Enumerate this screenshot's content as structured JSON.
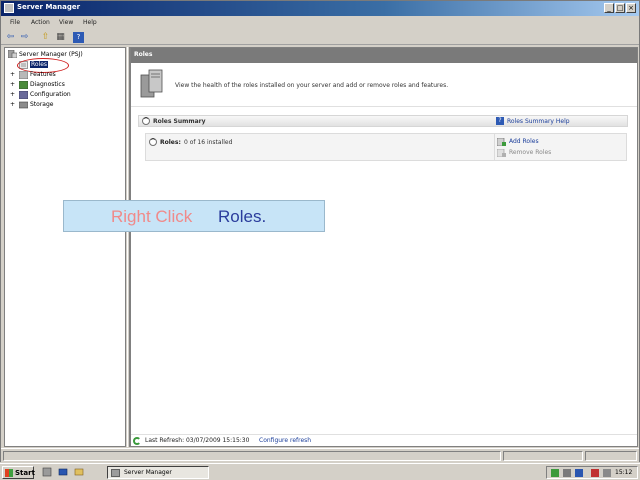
{
  "window": {
    "title": "Server Manager",
    "controls": {
      "minimize": "_",
      "maximize": "□",
      "close": "×"
    }
  },
  "menu": [
    "File",
    "Action",
    "View",
    "Help"
  ],
  "toolbar": {
    "buttons": [
      {
        "name": "back-icon",
        "glyph": "⇦"
      },
      {
        "name": "forward-icon",
        "glyph": "⇨"
      },
      {
        "name": "up-folder-icon",
        "glyph": "⇧"
      },
      {
        "name": "show-hide-tree-icon",
        "glyph": "▦"
      },
      {
        "name": "help-icon",
        "glyph": "?"
      }
    ]
  },
  "tree": {
    "root": "Server Manager (PSJ)",
    "items": [
      {
        "label": "Roles",
        "expander": "",
        "selected": true
      },
      {
        "label": "Features",
        "expander": "+"
      },
      {
        "label": "Diagnostics",
        "expander": "+"
      },
      {
        "label": "Configuration",
        "expander": "+"
      },
      {
        "label": "Storage",
        "expander": "+"
      }
    ]
  },
  "content": {
    "header": "Roles",
    "description": "View the health of the roles installed on your server and add or remove roles and features.",
    "section_title": "Roles Summary",
    "section_help": "Roles Summary Help",
    "roles_label": "Roles:",
    "roles_value": "0 of 16 installed",
    "actions": [
      {
        "label": "Add Roles",
        "enabled": true
      },
      {
        "label": "Remove Roles",
        "enabled": false
      }
    ],
    "refresh_text": "Last Refresh: 03/07/2009 15:15:30",
    "refresh_link": "Configure refresh"
  },
  "callout": {
    "part1": "Right Click",
    "part2": "Roles."
  },
  "taskbar": {
    "start": "Start",
    "task": "Server Manager",
    "clock": "15:12"
  },
  "colors": {
    "titlebar": "#0a246a",
    "link": "#1a3d9a",
    "callout_bg": "#c7e4f7",
    "callout_text1": "#f08a8a",
    "callout_text2": "#2a3c9c",
    "highlight_circle": "#d02020"
  }
}
